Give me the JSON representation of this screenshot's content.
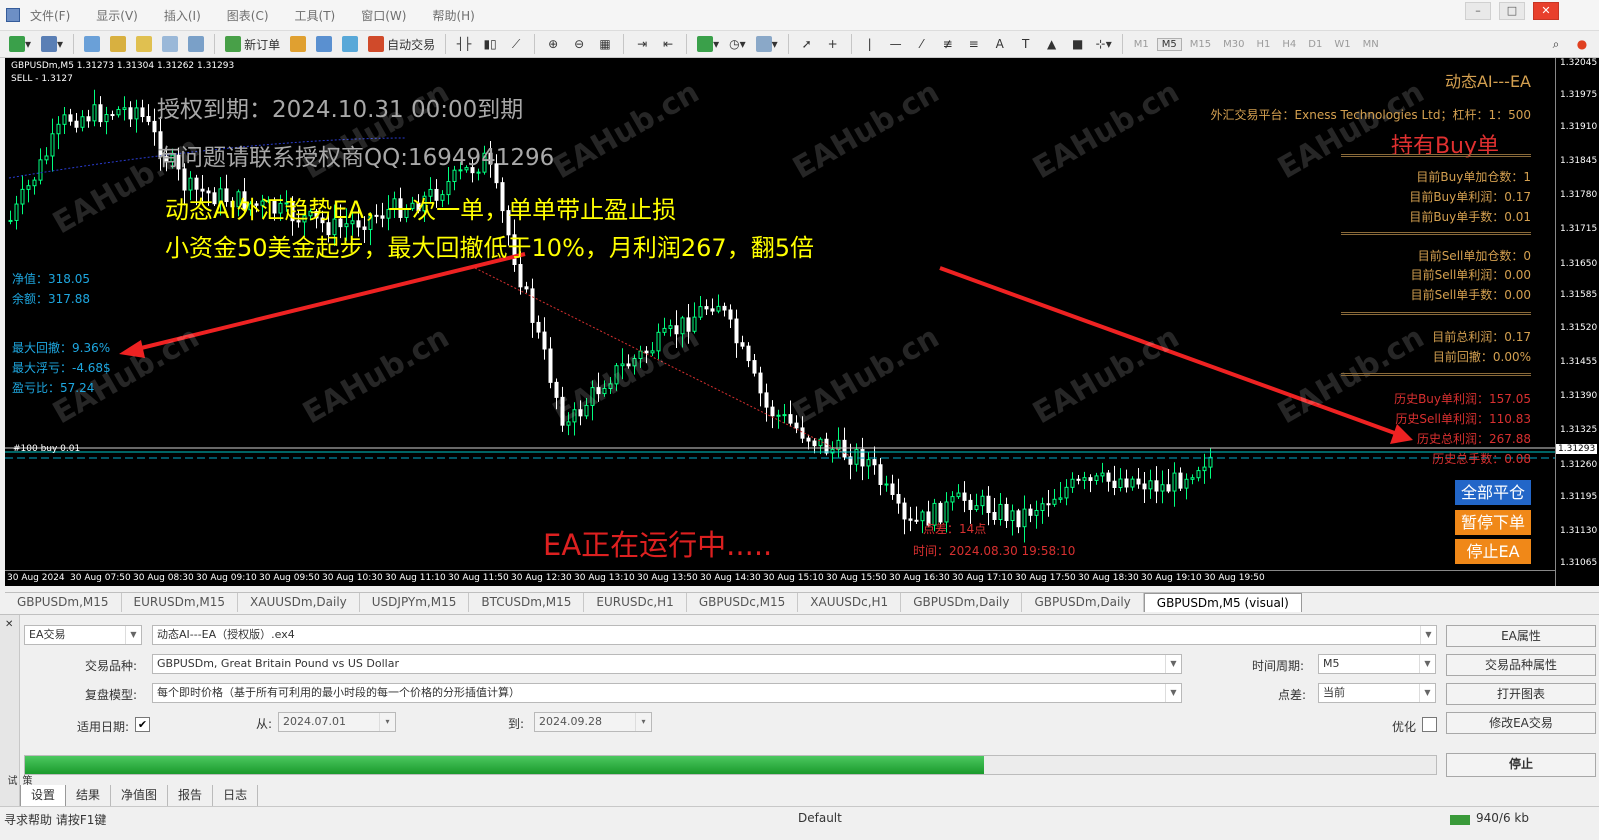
{
  "menu": {
    "items": [
      "文件(F)",
      "显示(V)",
      "插入(I)",
      "图表(C)",
      "工具(T)",
      "窗口(W)",
      "帮助(H)"
    ]
  },
  "toolbar": {
    "new_order": "新订单",
    "auto_trade": "自动交易",
    "text_tool": "A",
    "timeframes": [
      "M1",
      "M5",
      "M15",
      "M30",
      "H1",
      "H4",
      "D1",
      "W1",
      "MN"
    ],
    "active_timeframe": "M5"
  },
  "chart": {
    "header_line1": "GBPUSDm,M5  1.31273 1.31304 1.31262 1.31293",
    "header_line2": "SELL - 1.3127",
    "auth_line": "授权到期：2024.10.31 00:00到期",
    "contact_line": "有问题请联系授权商QQ:1694941296",
    "promo_line1": "动态AI外汇趋势EA，一次一单，单单带止盈止损",
    "promo_line2": "小资金50美金起步，最大回撤低于10%，月利润267，翻5倍",
    "running": "EA正在运行中.....",
    "order_label": "#100 buy 0.01",
    "spread": "点差：14点",
    "time": "时间：2024.08.30 19:58:10",
    "watermark": "EAHub.cn",
    "account": {
      "equity": "净值：318.05",
      "balance": "余额：317.88",
      "max_dd": "最大回撤：9.36%",
      "max_float": "最大浮亏：-4.68$",
      "pl_ratio": "盈亏比：57.24"
    },
    "right_panel": {
      "title": "动态AI---EA",
      "platform": "外汇交易平台：Exness Technologies Ltd；杠杆：1：500",
      "status": "持有Buy单",
      "buy_add": "目前Buy单加仓数：1",
      "buy_profit": "目前Buy单利润：0.17",
      "buy_lots": "目前Buy单手数：0.01",
      "sell_add": "目前Sell单加仓数：0",
      "sell_profit": "目前Sell单利润：0.00",
      "sell_lots": "目前Sell单手数：0.00",
      "total_profit": "目前总利润：0.17",
      "drawdown": "目前回撤：0.00%",
      "hist_buy": "历史Buy单利润：157.05",
      "hist_sell": "历史Sell单利润：110.83",
      "hist_total": "历史总利润：267.88",
      "hist_lots": "历史总手数：0.08"
    },
    "buttons": {
      "close_all": "全部平仓",
      "pause": "暂停下单",
      "stop_ea": "停止EA"
    },
    "price_axis": [
      "1.32045",
      "1.31975",
      "1.31910",
      "1.31845",
      "1.31780",
      "1.31715",
      "1.31650",
      "1.31585",
      "1.31520",
      "1.31455",
      "1.31390",
      "1.31325",
      "1.31293",
      "1.31260",
      "1.31195",
      "1.31130",
      "1.31065"
    ],
    "current_price": "1.31293",
    "time_axis": [
      "30 Aug 2024",
      "30 Aug 07:50",
      "30 Aug 08:30",
      "30 Aug 09:10",
      "30 Aug 09:50",
      "30 Aug 10:30",
      "30 Aug 11:10",
      "30 Aug 11:50",
      "30 Aug 12:30",
      "30 Aug 13:10",
      "30 Aug 13:50",
      "30 Aug 14:30",
      "30 Aug 15:10",
      "30 Aug 15:50",
      "30 Aug 16:30",
      "30 Aug 17:10",
      "30 Aug 17:50",
      "30 Aug 18:30",
      "30 Aug 19:10",
      "30 Aug 19:50"
    ]
  },
  "chart_tabs": [
    "GBPUSDm,M15",
    "EURUSDm,M15",
    "XAUUSDm,Daily",
    "USDJPYm,M15",
    "BTCUSDm,M15",
    "EURUSDc,H1",
    "GBPUSDc,M15",
    "XAUUSDc,H1",
    "GBPUSDm,Daily",
    "GBPUSDm,Daily",
    "GBPUSDm,M5 (visual)"
  ],
  "tester": {
    "type": "EA交易",
    "ea_name": "动态AI---EA（授权版）.ex4",
    "symbol_label": "交易品种:",
    "symbol": "GBPUSDm, Great Britain Pound vs US Dollar",
    "model_label": "复盘模型:",
    "model": "每个即时价格（基于所有可利用的最小时段的每一个价格的分形插值计算）",
    "use_date_label": "适用日期:",
    "from_label": "从:",
    "from": "2024.07.01",
    "to_label": "到:",
    "to": "2024.09.28",
    "period_label": "时间周期:",
    "period": "M5",
    "spread_label": "点差:",
    "spread": "当前",
    "optimize_label": "优化",
    "btn_ea_props": "EA属性",
    "btn_symbol_props": "交易品种属性",
    "btn_open_chart": "打开图表",
    "btn_modify_ea": "修改EA交易",
    "btn_stop": "停止",
    "progress": 0.68,
    "bottom_tabs": [
      "设置",
      "结果",
      "净值图",
      "报告",
      "日志"
    ],
    "side_label": "策略测试"
  },
  "status": {
    "help": "寻求帮助 请按F1键",
    "profile": "Default",
    "traffic": "940/6 kb"
  },
  "colors": {
    "chart_bg": "#000000",
    "bull": "#00ff7f",
    "bear": "#ffffff",
    "promo": "#ffff00",
    "accent_blue": "#1ea7e0",
    "alert_red": "#d83030"
  }
}
